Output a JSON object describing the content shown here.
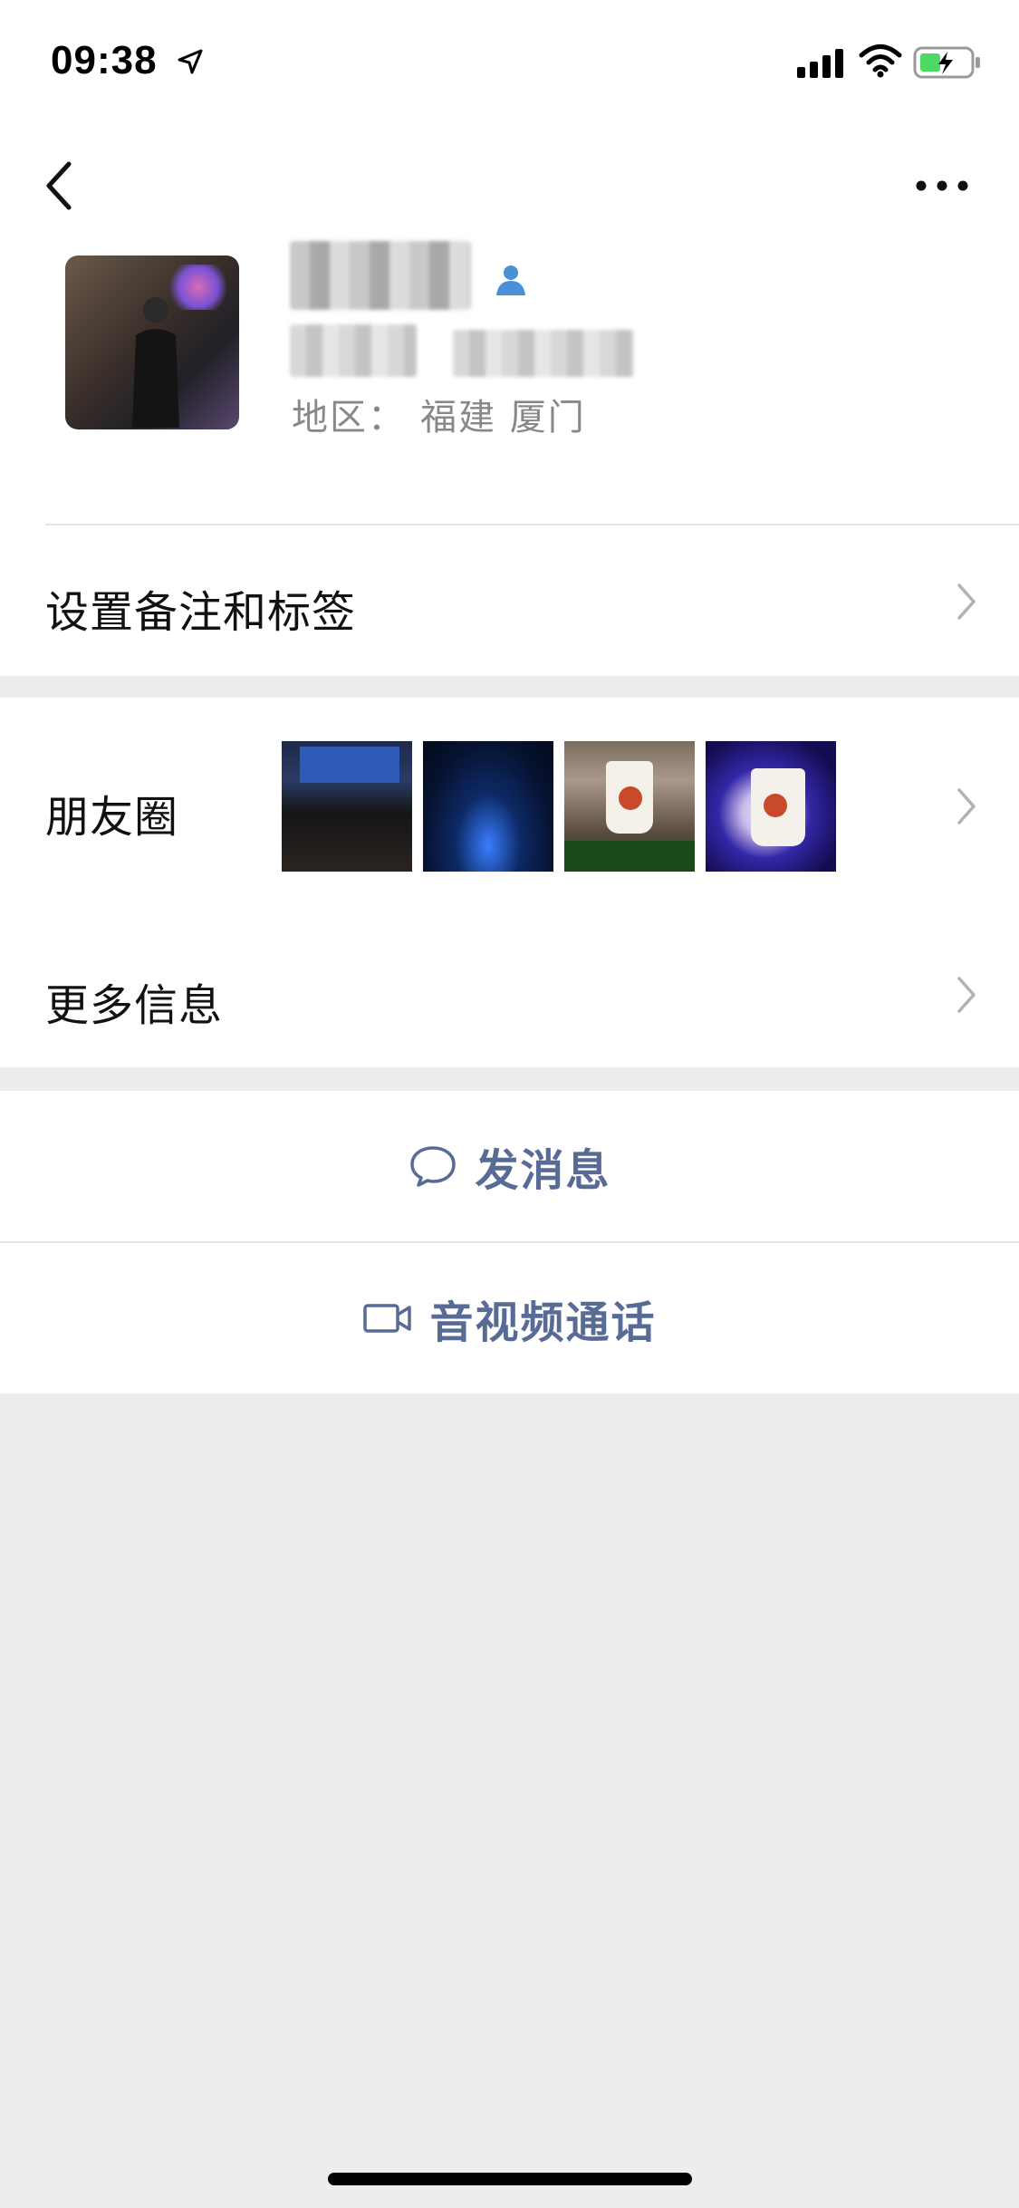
{
  "status_bar": {
    "time": "09:38",
    "icons": [
      "location-arrow-icon",
      "cellular-signal-icon",
      "wifi-icon",
      "battery-charging-icon"
    ],
    "battery_color": "#4cd964"
  },
  "nav": {
    "back_icon": "chevron-left-icon",
    "more_icon": "more-dots-icon"
  },
  "profile": {
    "region_label": "地区：",
    "region_value": "福建 厦门",
    "gender_icon": "person-icon",
    "gender_icon_color": "#4a90d9"
  },
  "rows": {
    "remark_label": "设置备注和标签",
    "moments_label": "朋友圈",
    "more_info_label": "更多信息"
  },
  "actions": {
    "message_label": "发消息",
    "call_label": "音视频通话",
    "accent_color": "#576b95"
  }
}
